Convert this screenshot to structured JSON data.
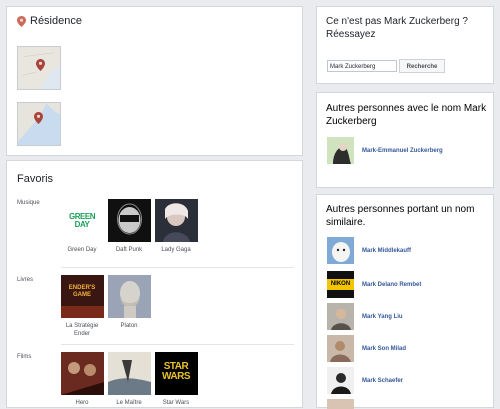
{
  "residence": {
    "title": "Résidence",
    "maps": [
      "map-1",
      "map-2"
    ]
  },
  "favoris": {
    "title": "Favoris",
    "sections": [
      {
        "label": "Musique",
        "items": [
          {
            "caption": "Green Day"
          },
          {
            "caption": "Daft Punk"
          },
          {
            "caption": "Lady Gaga"
          }
        ]
      },
      {
        "label": "Livres",
        "items": [
          {
            "caption": "La Stratégie Ender"
          },
          {
            "caption": "Platon"
          }
        ]
      },
      {
        "label": "Films",
        "items": [
          {
            "caption": "Hero"
          },
          {
            "caption": "Le Maître"
          },
          {
            "caption": "Star Wars"
          }
        ]
      }
    ],
    "art_text": {
      "green_day": "GREEN DAY",
      "ender": "ENDER'S GAME",
      "star_wars": "STAR WARS"
    }
  },
  "search": {
    "question": "Ce n'est pas Mark Zuckerberg ? Réessayez",
    "input_value": "Mark Zuckerberg",
    "button_label": "Recherche"
  },
  "others": {
    "title": "Autres personnes avec le nom Mark Zuckerberg",
    "people": [
      {
        "name": "Mark-Emmanuel Zuckerberg"
      }
    ]
  },
  "similar": {
    "title": "Autres personnes portant un nom similaire.",
    "people": [
      {
        "name": "Mark Middlekauff"
      },
      {
        "name": "Mark Delano Rembet"
      },
      {
        "name": "Mark Yang Liu"
      },
      {
        "name": "Mark Son Milad"
      },
      {
        "name": "Mark Schaefer"
      }
    ],
    "avatar_text": {
      "nikon": "NIKON"
    }
  },
  "colors": {
    "link": "#365899",
    "background": "#e9ebee",
    "pin": "#c0392b"
  }
}
